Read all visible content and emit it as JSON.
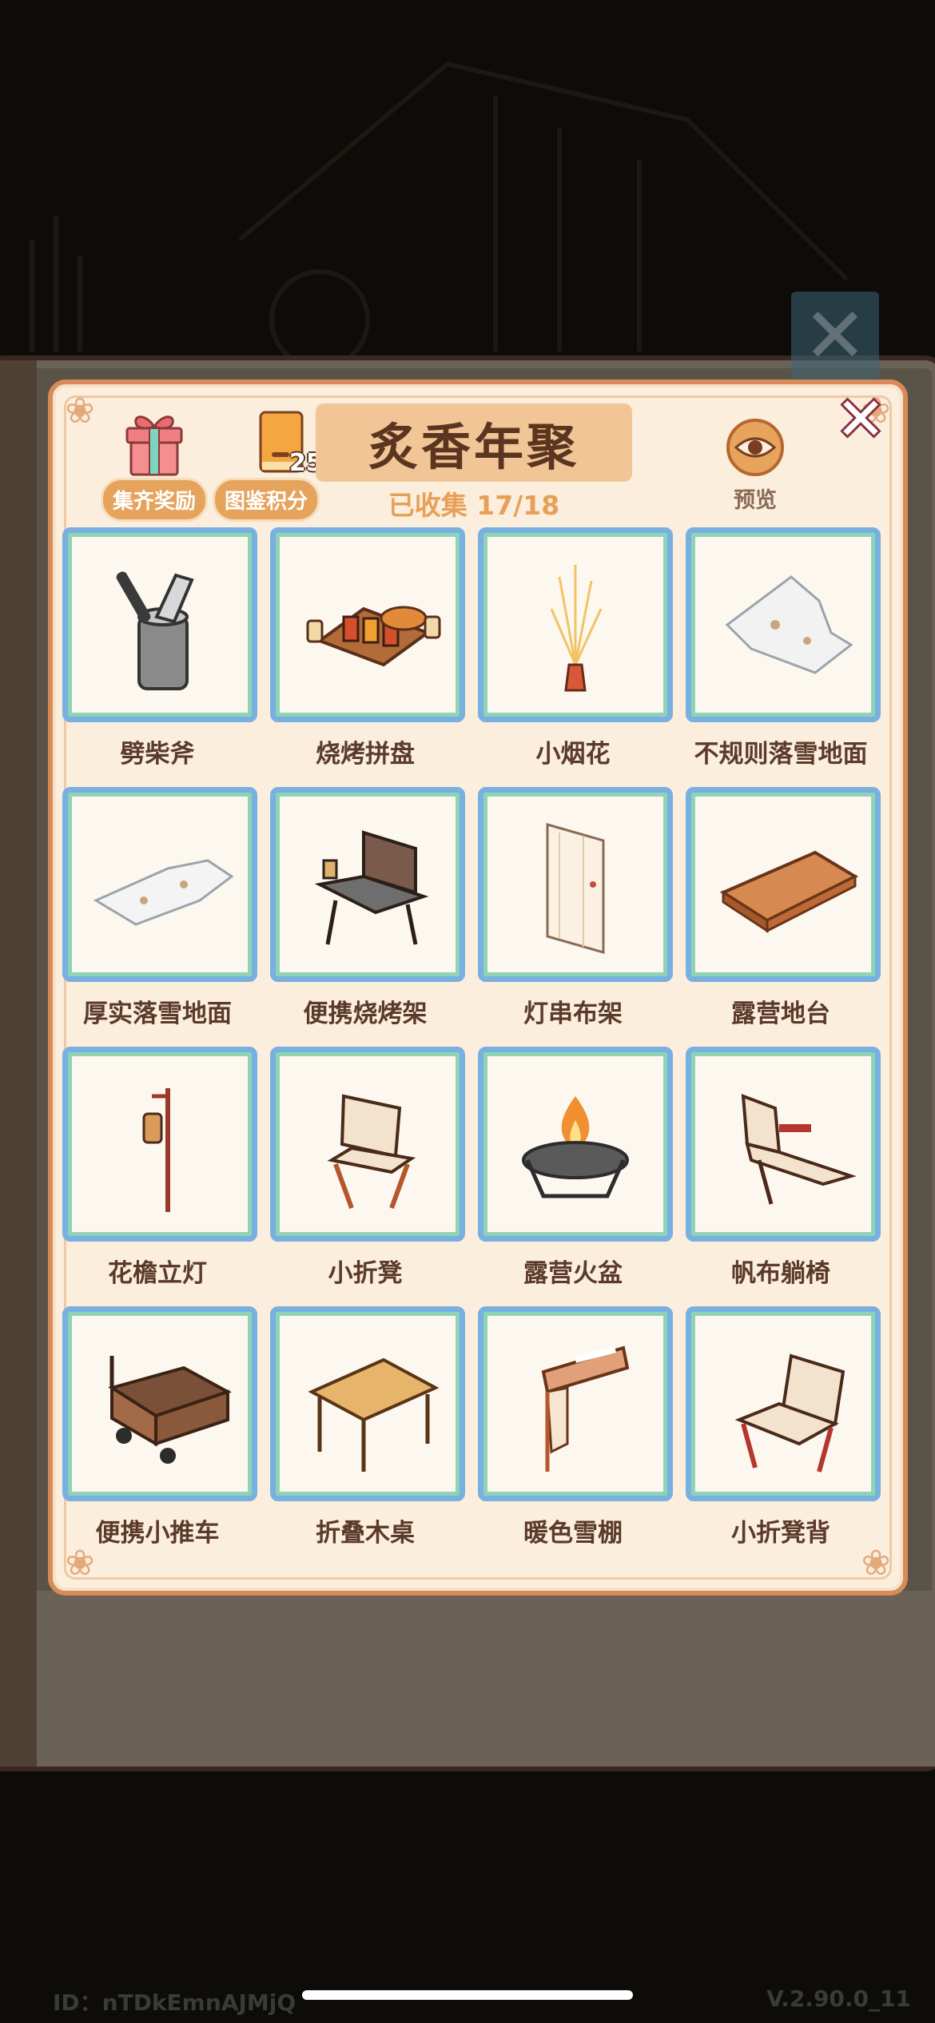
{
  "header": {
    "title": "炙香年聚",
    "collected_text": "已收集 17/18",
    "reward_button_label": "集齐奖励",
    "points_button_label": "图鉴积分",
    "points_value": "25",
    "preview_label": "预览"
  },
  "items": [
    {
      "name": "劈柴斧",
      "icon": "axe-in-stump"
    },
    {
      "name": "烧烤拼盘",
      "icon": "bbq-platter"
    },
    {
      "name": "小烟花",
      "icon": "sparkler-firework"
    },
    {
      "name": "不规则落雪地面",
      "icon": "irregular-snow-ground"
    },
    {
      "name": "厚实落雪地面",
      "icon": "thick-snow-ground"
    },
    {
      "name": "便携烧烤架",
      "icon": "portable-grill"
    },
    {
      "name": "灯串布架",
      "icon": "string-light-curtain"
    },
    {
      "name": "露营地台",
      "icon": "camping-platform"
    },
    {
      "name": "花檐立灯",
      "icon": "standing-lantern"
    },
    {
      "name": "小折凳",
      "icon": "folding-stool"
    },
    {
      "name": "露营火盆",
      "icon": "fire-pit"
    },
    {
      "name": "帆布躺椅",
      "icon": "canvas-lounger"
    },
    {
      "name": "便携小推车",
      "icon": "wagon-cart"
    },
    {
      "name": "折叠木桌",
      "icon": "folding-wood-table"
    },
    {
      "name": "暖色雪棚",
      "icon": "warm-snow-canopy"
    },
    {
      "name": "小折凳背",
      "icon": "folding-chair-back"
    }
  ],
  "footer": {
    "id_text": "ID：nTDkEmnAJMjQ",
    "version_text": "V.2.90.0_11"
  },
  "colors": {
    "frame_blue": "#78b0e0",
    "frame_green": "#8fd3b7",
    "title_bg": "#f2c597",
    "accent_orange": "#e5a35c"
  }
}
